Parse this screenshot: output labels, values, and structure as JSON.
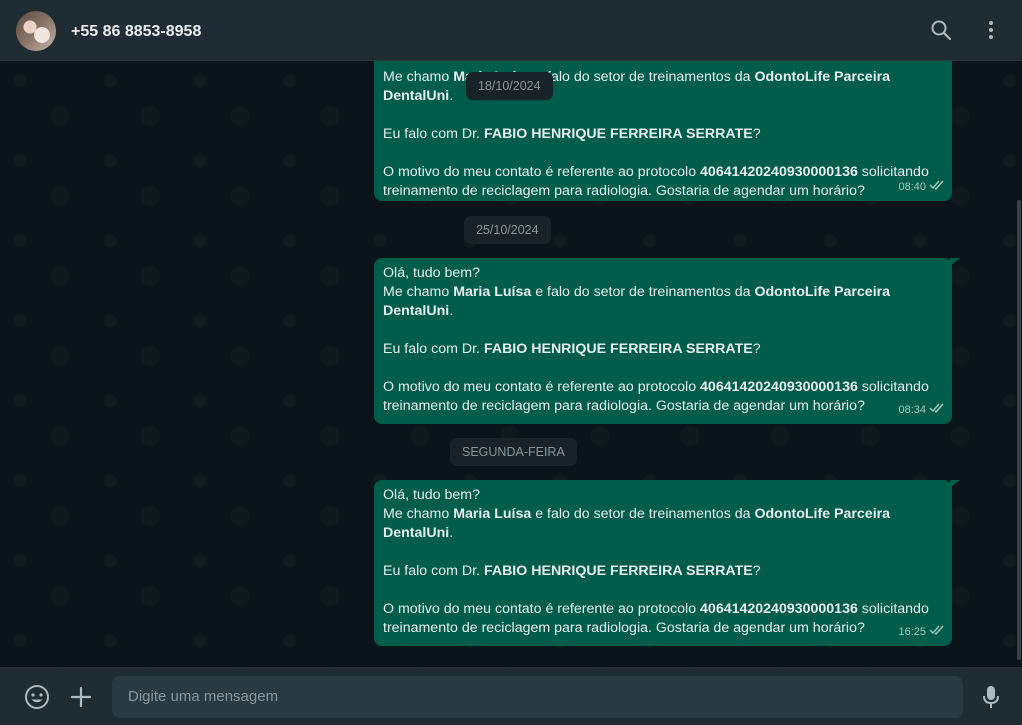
{
  "header": {
    "contact_name": "+55 86 8853-8958",
    "icons": [
      "search-icon",
      "menu-dots-icon"
    ]
  },
  "chat": {
    "items": [
      {
        "type": "message",
        "direction": "outgoing",
        "lines": {
          "l2a": "Me chamo ",
          "l2b": "Maria Luísa",
          "l2c": " e falo do setor de treinamentos da ",
          "l2d": "OdontoLife Parceira DentalUni",
          "l2e": ".",
          "l3a": "Eu falo com Dr. ",
          "l3b": "FABIO HENRIQUE FERREIRA SERRATE",
          "l3c": "?",
          "l4a": "O motivo do meu contato é referente ao protocolo ",
          "l4b": "40641420240930000136",
          "l4c": " solicitando treinamento de reciclagem para radiologia. Gostaria de agendar um horário?"
        },
        "time": "08:40",
        "status": "read"
      },
      {
        "type": "date",
        "label": "18/10/2024"
      },
      {
        "type": "date",
        "label": "25/10/2024"
      },
      {
        "type": "message",
        "direction": "outgoing",
        "lines": {
          "l1": "Olá, tudo bem?",
          "l2a": "Me chamo ",
          "l2b": "Maria Luísa",
          "l2c": " e falo do setor de treinamentos da ",
          "l2d": "OdontoLife Parceira DentalUni",
          "l2e": ".",
          "l3a": "Eu falo com Dr. ",
          "l3b": "FABIO HENRIQUE FERREIRA SERRATE",
          "l3c": "?",
          "l4a": "O motivo do meu contato é referente ao protocolo ",
          "l4b": "40641420240930000136",
          "l4c": " solicitando treinamento de reciclagem para radiologia. Gostaria de agendar um horário?"
        },
        "time": "08:34",
        "status": "read"
      },
      {
        "type": "date",
        "label": "SEGUNDA-FEIRA"
      },
      {
        "type": "message",
        "direction": "outgoing",
        "lines": {
          "l1": "Olá, tudo bem?",
          "l2a": "Me chamo ",
          "l2b": "Maria Luísa",
          "l2c": " e falo do setor de treinamentos da ",
          "l2d": "OdontoLife Parceira DentalUni",
          "l2e": ".",
          "l3a": "Eu falo com Dr. ",
          "l3b": "FABIO HENRIQUE FERREIRA SERRATE",
          "l3c": "?",
          "l4a": "O motivo do meu contato é referente ao protocolo ",
          "l4b": "40641420240930000136",
          "l4c": " solicitando treinamento de reciclagem para radiologia. Gostaria de agendar um horário?"
        },
        "time": "16:25",
        "status": "read"
      }
    ]
  },
  "composer": {
    "placeholder": "Digite uma mensagem",
    "icons": [
      "emoji-icon",
      "plus-icon",
      "mic-icon"
    ]
  },
  "colors": {
    "outgoing_bubble": "#005c4b",
    "chat_background": "#0b141a",
    "header_background": "#202c33",
    "date_chip": "#182229",
    "read_ticks": "#a9c8c0"
  }
}
